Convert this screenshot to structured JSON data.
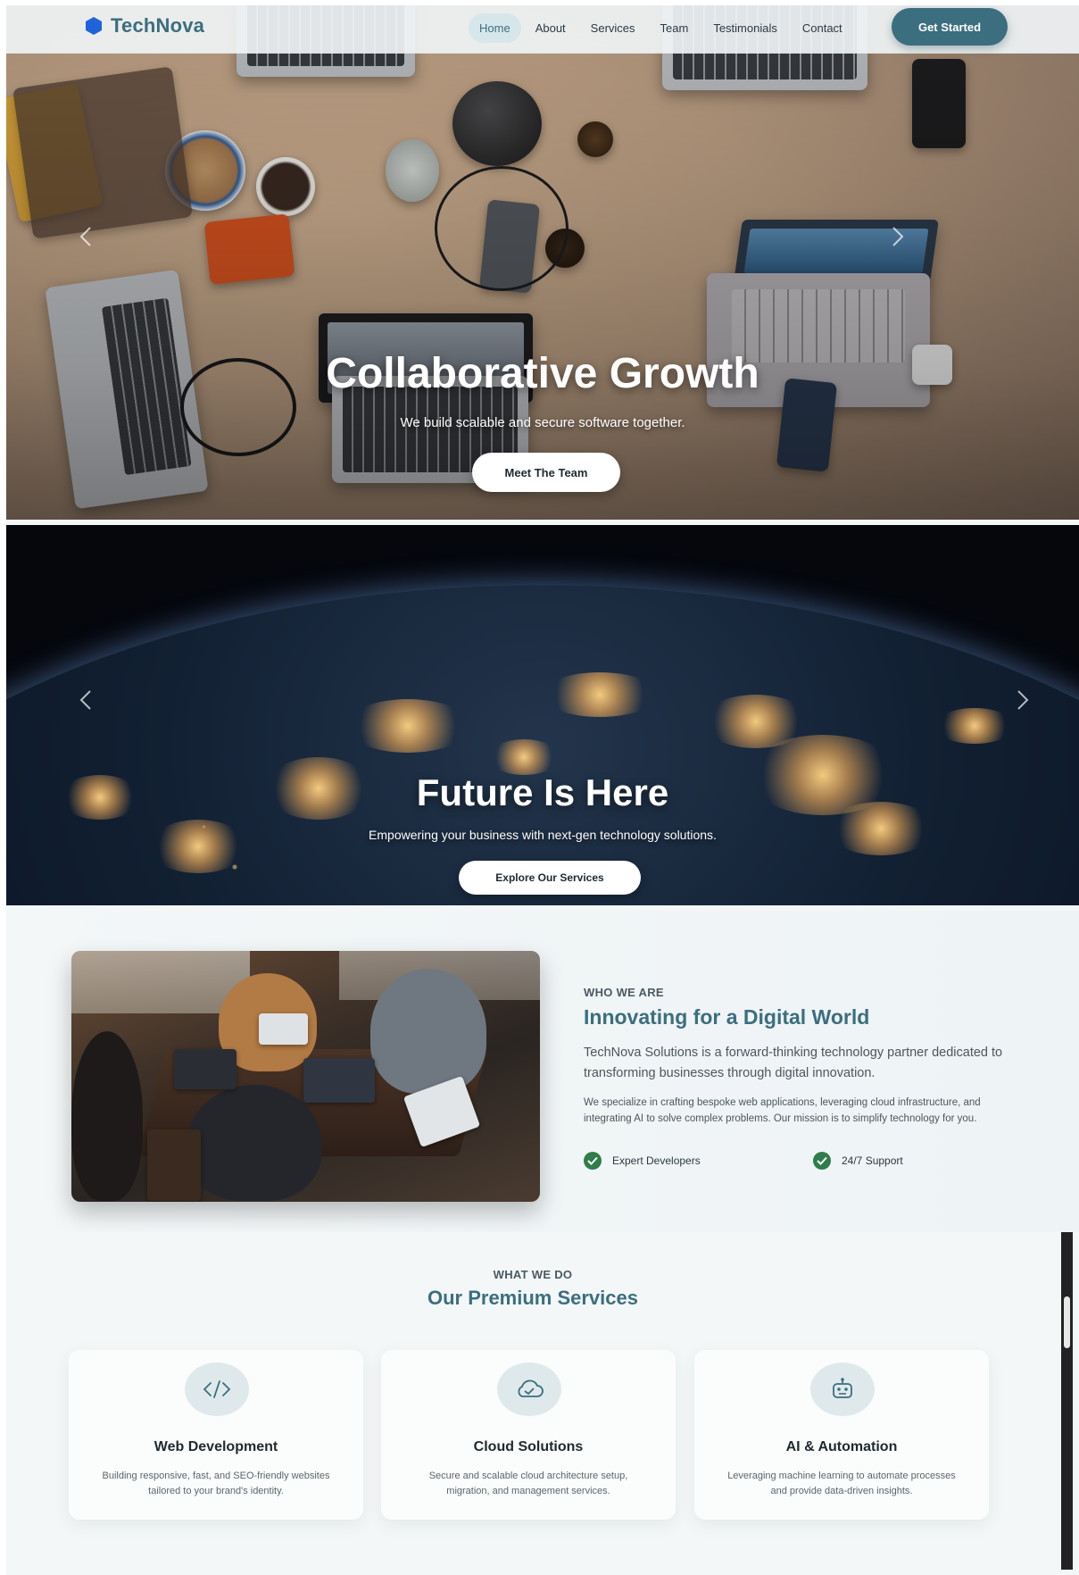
{
  "brand": {
    "name": "TechNova",
    "color": "#3b6e7f"
  },
  "nav": {
    "links": [
      {
        "label": "Home",
        "active": true
      },
      {
        "label": "About"
      },
      {
        "label": "Services"
      },
      {
        "label": "Team"
      },
      {
        "label": "Testimonials"
      },
      {
        "label": "Contact"
      }
    ],
    "cta_label": "Get Started"
  },
  "slides": [
    {
      "title": "Collaborative Growth",
      "subtitle": "We build scalable and secure software together.",
      "button_label": "Meet The Team"
    },
    {
      "title": "Future Is Here",
      "subtitle": "Empowering your business with next-gen technology solutions.",
      "button_label": "Explore Our Services"
    }
  ],
  "about": {
    "eyebrow": "WHO WE ARE",
    "title": "Innovating for a Digital World",
    "lead": "TechNova Solutions is a forward-thinking technology partner dedicated to transforming businesses through digital innovation.",
    "body": "We specialize in crafting bespoke web applications, leveraging cloud infrastructure, and integrating AI to solve complex problems. Our mission is to simplify technology for you.",
    "features": [
      "Expert Developers",
      "24/7 Support"
    ]
  },
  "services": {
    "eyebrow": "WHAT WE DO",
    "title": "Our Premium Services",
    "items": [
      {
        "icon": "code-icon",
        "title": "Web Development",
        "description": "Building responsive, fast, and SEO-friendly websites tailored to your brand's identity."
      },
      {
        "icon": "cloud-check-icon",
        "title": "Cloud Solutions",
        "description": "Secure and scalable cloud architecture setup, migration, and management services."
      },
      {
        "icon": "robot-icon",
        "title": "AI & Automation",
        "description": "Leveraging machine learning to automate processes and provide data-driven insights."
      }
    ]
  },
  "colors": {
    "accent": "#3b6e7f",
    "success": "#2f7d4a"
  }
}
